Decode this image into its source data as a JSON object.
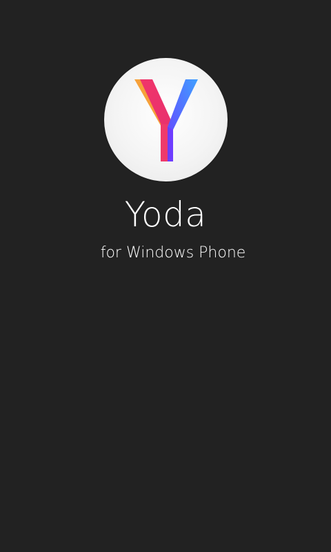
{
  "splash": {
    "logo_icon": "yoda-y-logo-icon",
    "logo_letter": "Y",
    "title": "Yoda",
    "subtitle": "for Windows Phone"
  },
  "colors": {
    "background": "#222222",
    "text": "#ffffff",
    "logo_circle": "#f4f4f4",
    "logo_pink": "#f0356a",
    "logo_orange": "#f6a13a",
    "logo_blue": "#3f8cff",
    "logo_purple": "#7c3cff"
  }
}
